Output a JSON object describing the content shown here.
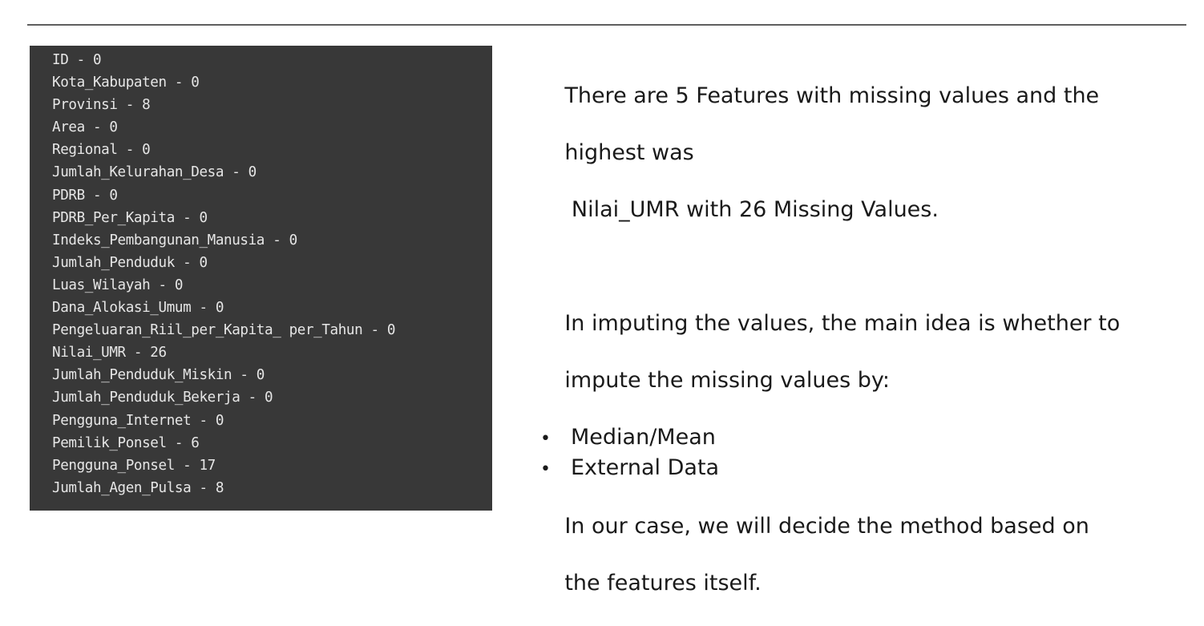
{
  "console": {
    "lines": [
      "ID - 0",
      "Kota_Kabupaten - 0",
      "Provinsi - 8",
      "Area - 0",
      "Regional - 0",
      "Jumlah_Kelurahan_Desa - 0",
      "PDRB - 0",
      "PDRB_Per_Kapita - 0",
      "Indeks_Pembangunan_Manusia - 0",
      "Jumlah_Penduduk - 0",
      "Luas_Wilayah - 0",
      "Dana_Alokasi_Umum - 0",
      "Pengeluaran_Riil_per_Kapita_ per_Tahun - 0",
      "Nilai_UMR - 26",
      "Jumlah_Penduduk_Miskin - 0",
      "Jumlah_Penduduk_Bekerja - 0",
      "Pengguna_Internet - 0",
      "Pemilik_Ponsel - 6",
      "Pengguna_Ponsel - 17",
      "Jumlah_Agen_Pulsa - 8"
    ]
  },
  "notes": {
    "summary_line_1": "There are 5 Features with missing values and the",
    "summary_line_2": "highest was",
    "summary_line_3": " Nilai_UMR with 26 Missing Values.",
    "impute_line_1": "In imputing the values, the main idea is whether to",
    "impute_line_2": "impute the missing values by:",
    "bullet_char": "•",
    "options": [
      "Median/Mean",
      "External Data"
    ],
    "conclusion_line_1": "In our case, we will decide the method based on",
    "conclusion_line_2": "the features itself."
  }
}
